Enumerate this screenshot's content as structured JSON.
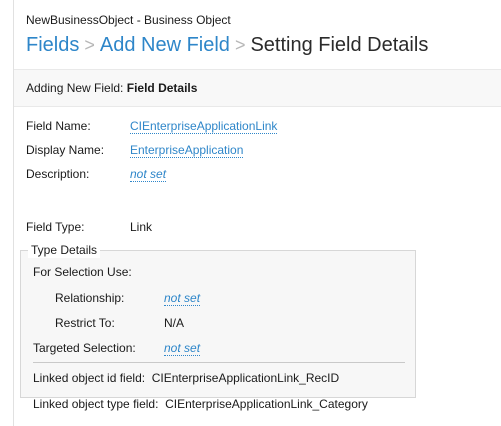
{
  "header": {
    "object_title": "NewBusinessObject - Business Object",
    "breadcrumbs": [
      {
        "label": "Fields"
      },
      {
        "label": "Add New Field"
      },
      {
        "label": "Setting Field Details"
      }
    ],
    "separator": ">"
  },
  "subheader": {
    "prefix": "Adding New Field:",
    "title": "Field Details"
  },
  "fields": {
    "field_name_label": "Field Name:",
    "field_name_value": "CIEnterpriseApplicationLink",
    "display_name_label": "Display Name:",
    "display_name_value": "EnterpriseApplication",
    "description_label": "Description:",
    "description_value": "not set",
    "field_type_label": "Field Type:",
    "field_type_value": "Link"
  },
  "type_details": {
    "legend": "Type Details",
    "for_selection_use": "For Selection Use:",
    "relationship_label": "Relationship:",
    "relationship_value": "not set",
    "restrict_to_label": "Restrict To:",
    "restrict_to_value": "N/A",
    "targeted_selection_label": "Targeted Selection:",
    "targeted_selection_value": "not set",
    "linked_id_label": "Linked object id field:",
    "linked_id_value": "CIEnterpriseApplicationLink_RecID",
    "linked_type_label": "Linked object type field:",
    "linked_type_value": "CIEnterpriseApplicationLink_Category"
  },
  "colors": {
    "link": "#2e86c9",
    "separator": "#b7b7b7",
    "box_background": "#f7f7f7",
    "bar_background": "#f8f8f8"
  }
}
